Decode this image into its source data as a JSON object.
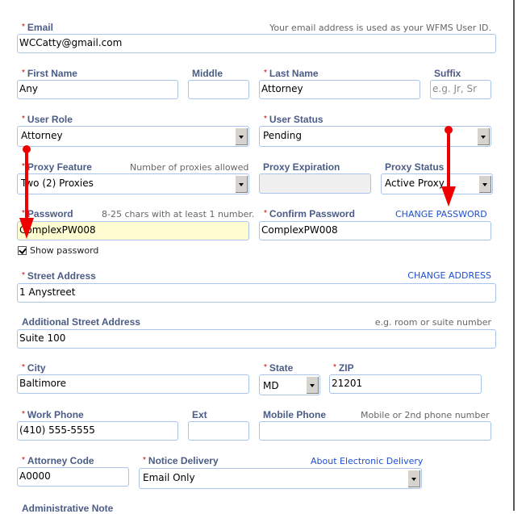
{
  "form": {
    "email": {
      "label": "Email",
      "hint": "Your email address is used as your WFMS User ID.",
      "value": "WCCatty@gmail.com"
    },
    "first_name": {
      "label": "First Name",
      "value": "Any"
    },
    "middle": {
      "label": "Middle",
      "value": ""
    },
    "last_name": {
      "label": "Last Name",
      "value": "Attorney"
    },
    "suffix": {
      "label": "Suffix",
      "placeholder": "e.g. Jr, Sr"
    },
    "user_role": {
      "label": "User Role",
      "value": "Attorney"
    },
    "user_status": {
      "label": "User Status",
      "value": "Pending"
    },
    "proxy_feature": {
      "label": "Proxy Feature",
      "hint": "Number of proxies allowed",
      "value": "Two (2) Proxies"
    },
    "proxy_expiration": {
      "label": "Proxy Expiration",
      "value": ""
    },
    "proxy_status": {
      "label": "Proxy Status",
      "value": "Active Proxy"
    },
    "password": {
      "label": "Password",
      "hint": "8-25 chars with at least 1 number.",
      "value": "ComplexPW008"
    },
    "confirm_password": {
      "label": "Confirm Password",
      "value": "ComplexPW008"
    },
    "change_password_link": "CHANGE PASSWORD",
    "show_password": {
      "label": "Show password",
      "checked": true
    },
    "street_address": {
      "label": "Street Address",
      "value": "1 Anystreet"
    },
    "change_address_link": "CHANGE ADDRESS",
    "additional_address": {
      "label": "Additional Street Address",
      "hint": "e.g. room or suite number",
      "value": "Suite 100"
    },
    "city": {
      "label": "City",
      "value": "Baltimore"
    },
    "state": {
      "label": "State",
      "value": "MD"
    },
    "zip": {
      "label": "ZIP",
      "value": "21201"
    },
    "work_phone": {
      "label": "Work Phone",
      "value": "(410) 555-5555"
    },
    "ext": {
      "label": "Ext",
      "value": ""
    },
    "mobile_phone": {
      "label": "Mobile Phone",
      "hint": "Mobile or 2nd phone number",
      "value": ""
    },
    "attorney_code": {
      "label": "Attorney Code",
      "value": "A0000"
    },
    "notice_delivery": {
      "label": "Notice Delivery",
      "value": "Email Only"
    },
    "about_electronic_delivery_link": "About Electronic Delivery",
    "administrative_note": {
      "label": "Administrative Note"
    }
  },
  "required_marker": "*",
  "annotations": {
    "arrow_color": "#ee0000"
  }
}
